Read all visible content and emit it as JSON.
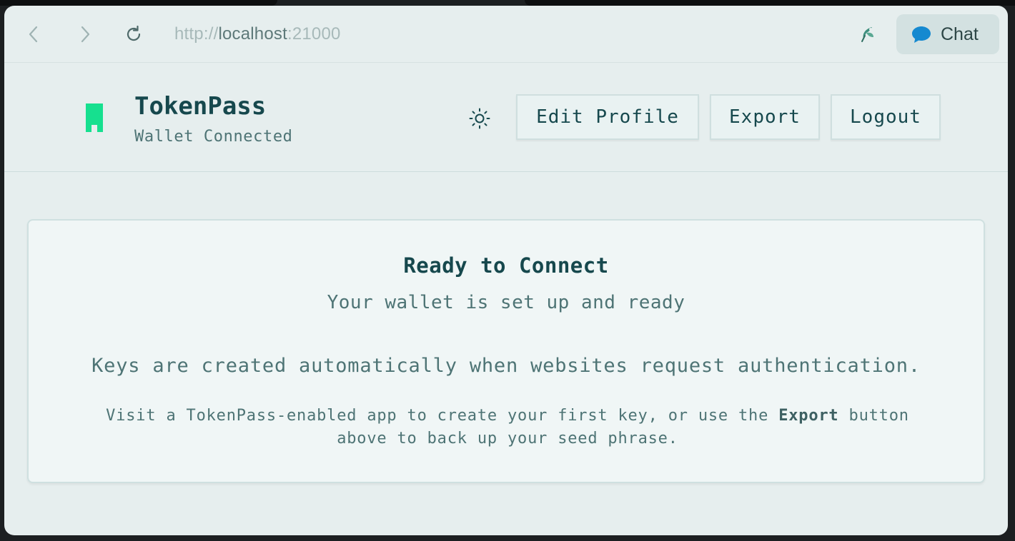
{
  "browser": {
    "url_scheme": "http://",
    "url_host": "localhost",
    "url_port": ":21000",
    "chat_label": "Chat"
  },
  "header": {
    "title": "TokenPass",
    "subtitle": "Wallet Connected",
    "edit_profile_label": "Edit Profile",
    "export_label": "Export",
    "logout_label": "Logout"
  },
  "card": {
    "title": "Ready to Connect",
    "subtitle": "Your wallet is set up and ready",
    "description": "Keys are created automatically when websites request authentication.",
    "hint_before": "Visit a TokenPass-enabled app to create your first key, or use the ",
    "hint_bold": "Export",
    "hint_after": " button above to back up your seed phrase."
  },
  "colors": {
    "accent": "#16e08f",
    "text_primary": "#16484d",
    "text_secondary": "#4e7475",
    "background": "#e6eeee",
    "card_background": "#f0f6f6"
  },
  "icons": {
    "back": "chevron-left-icon",
    "forward": "chevron-right-icon",
    "reload": "reload-icon",
    "extension": "extension-icon",
    "chat": "chat-bubble-icon",
    "theme": "sun-icon",
    "logo": "bookmark-logo-icon"
  }
}
